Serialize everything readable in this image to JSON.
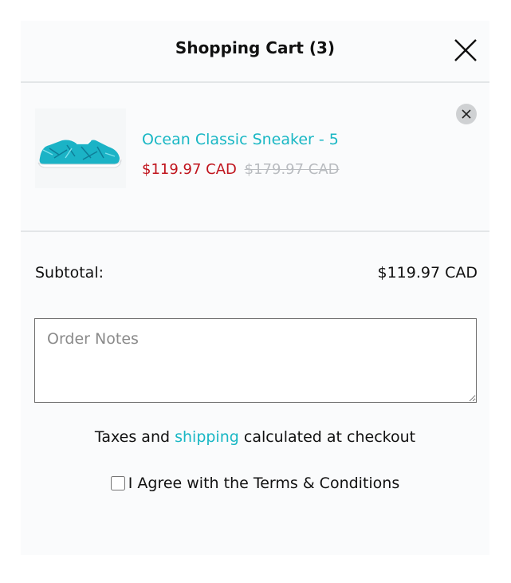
{
  "header": {
    "title": "Shopping Cart (3)"
  },
  "cart_item": {
    "name": "Ocean Classic Sneaker - 5",
    "sale_price": "$119.97 CAD",
    "original_price": "$179.97 CAD",
    "image_icon": "sneaker-image"
  },
  "summary": {
    "subtotal_label": "Subtotal:",
    "subtotal_value": "$119.97 CAD"
  },
  "notes": {
    "placeholder": "Order Notes"
  },
  "tax_info": {
    "before": "Taxes and ",
    "link": "shipping",
    "after": " calculated at checkout"
  },
  "terms": {
    "label": "I Agree with the Terms & Conditions",
    "checked": false
  },
  "colors": {
    "accent": "#19b7c4",
    "sale": "#c0141d",
    "muted": "#b9bcc0",
    "divider": "#e3e6e8"
  }
}
